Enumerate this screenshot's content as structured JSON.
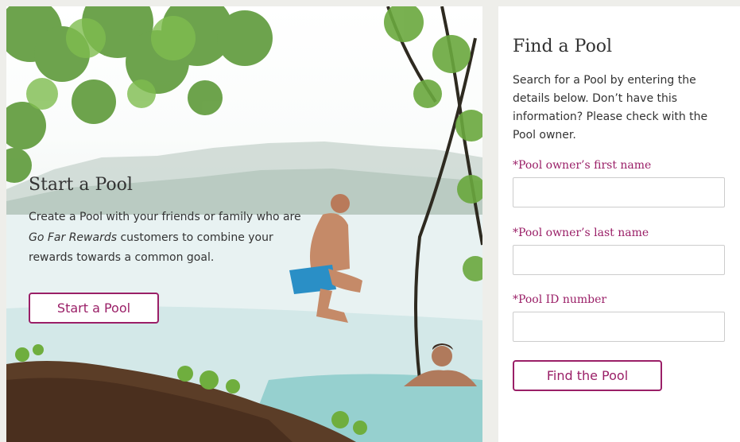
{
  "hero": {
    "title": "Start a Pool",
    "desc_before": "Create a Pool with your friends or family who are ",
    "desc_italic": "Go Far Rewards",
    "desc_after": " customers to combine your rewards towards a common goal.",
    "button_label": "Start a Pool"
  },
  "find": {
    "title": "Find a Pool",
    "description": "Search for a Pool by entering the details below. Don’t have this information? Please check with the Pool owner.",
    "fields": [
      {
        "label": "*Pool owner’s first name",
        "value": ""
      },
      {
        "label": "*Pool owner’s last name",
        "value": ""
      },
      {
        "label": "*Pool ID number",
        "value": ""
      }
    ],
    "button_label": "Find the Pool"
  },
  "colors": {
    "accent": "#9a1f67",
    "text": "#333333",
    "page_bg": "#eeeeea"
  }
}
